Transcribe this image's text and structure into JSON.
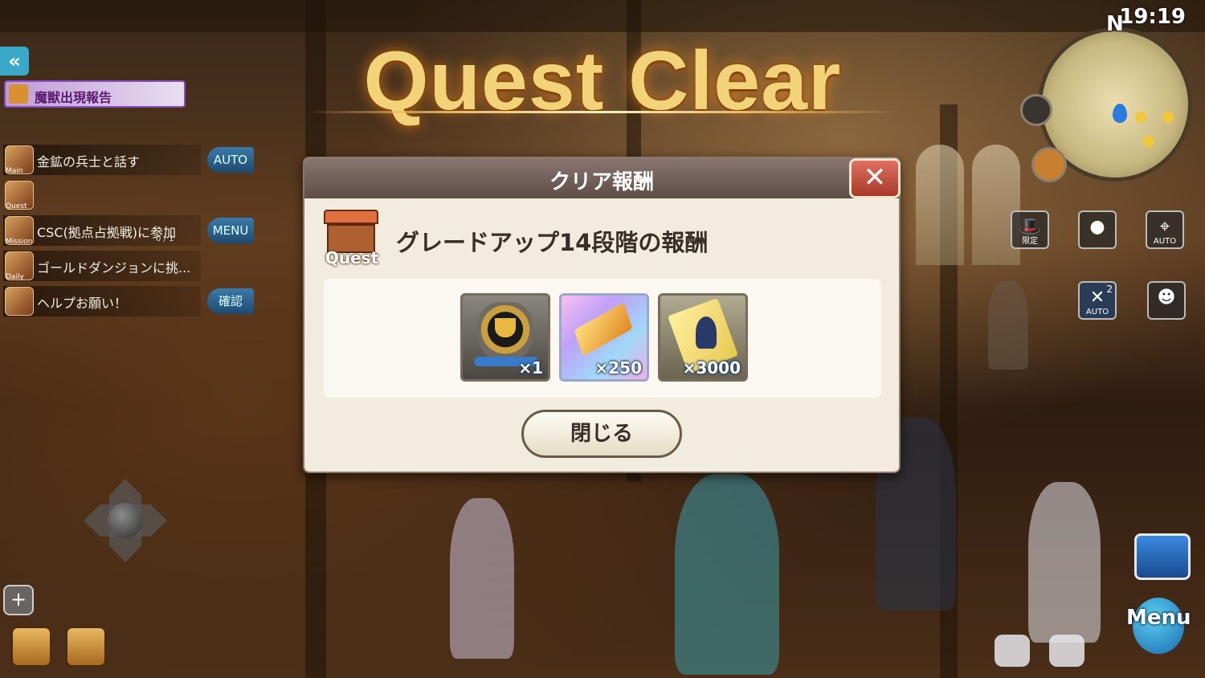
{
  "header": {
    "title": "Quest Clear",
    "clock": "19:19",
    "compass": "N"
  },
  "left_panel": {
    "beast_report": "魔獣出現報告",
    "quests": [
      {
        "tag": "Main",
        "text": "金鉱の兵士と話す",
        "sub": "",
        "button": "AUTO"
      },
      {
        "tag": "Quest",
        "text": "",
        "sub": "",
        "button": ""
      },
      {
        "tag": "Mission",
        "text": "CSC(拠点占拠戦)に参加",
        "sub": "0 / 1",
        "button": "MENU"
      },
      {
        "tag": "Daily",
        "text": "ゴールドダンジョンに挑...",
        "sub": "",
        "button": ""
      },
      {
        "tag": "",
        "text": "ヘルプお願い！",
        "sub": "",
        "button": "確認"
      }
    ]
  },
  "right_panel": {
    "limited_label": "限定",
    "auto_label": "AUTO",
    "skill_auto_label": "AUTO",
    "skill_count": "2",
    "menu_label": "Menu"
  },
  "dialog": {
    "title": "クリア報酬",
    "quest_label": "Quest",
    "reward_title": "グレードアップ14段階の報酬",
    "items": [
      {
        "name": "trophy",
        "qty": "×1"
      },
      {
        "name": "gold-bar",
        "qty": "×250"
      },
      {
        "name": "ticket",
        "qty": "×3000"
      }
    ],
    "close_label": "閉じる"
  },
  "colors": {
    "title_gold": "#f3d37a",
    "dialog_bg": "#f2ecde",
    "header": "#5e4c46",
    "close_red": "#c04a38",
    "auto_blue": "#2e5e88"
  }
}
